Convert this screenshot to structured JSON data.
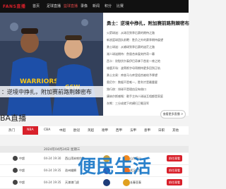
{
  "nav": {
    "logo": "FANS直播",
    "items": [
      "首页",
      "足球直播",
      "篮球直播",
      "录像",
      "新闻",
      "积分",
      "比赛"
    ],
    "active_index": 2
  },
  "hero": {
    "caption": "：逆境中挣扎，附加赛前路荆棘密布"
  },
  "news": {
    "title": "勇士：逆境中挣扎，附加赛前路荆棘密布",
    "items": [
      "火箭球迷：从球员到季后赛的期待之路",
      "新浪篮球团队前瞻：胜负之外的赛季期待展望",
      "勇士球迷：从输球到季后赛的迷茫之路",
      "湖人球迷期待：詹眉合体复刻传奇一幕",
      "西卡：欣慰伏尔泰伊巴奇拿下首发一席之地",
      "雄鹿开场：波蒂斯字母哥期待更多回到正轨",
      "勇士交易：库兹马与库里组合被给予厚望",
      "奥尼尔：数据不是唯一，胜利才是最重要",
      "独行侠：排球不是理由没有借口",
      "康纳尔斯感慨：歌手主持人球迷互相都是家庭",
      "灰熊：三分成就下的横扫卫冕冠军"
    ]
  },
  "section": {
    "title": "BA直播",
    "more_label": "查看更多直播 >"
  },
  "tabs": [
    "热门",
    "NBA",
    "CBA",
    "中超",
    "欧冠",
    "英超",
    "德甲",
    "西甲",
    "法甲",
    "意甲",
    "日职",
    "其他"
  ],
  "active_tab": 1,
  "date_label": "2024年04月24日 星期三",
  "matches": [
    {
      "league": "中超",
      "time": "04-24 19:30",
      "home": "西山湾米哈尔苏",
      "away": "山东泰山",
      "button": "前往观看",
      "home_color": "#c8a040",
      "away_color": "#f08a20"
    },
    {
      "league": "中超",
      "time": "04-24 19:35",
      "home": "沧州雄狮",
      "away": "武汉三镇",
      "button": "前往观看",
      "home_color": "#2c5db8",
      "away_color": "#f07020"
    },
    {
      "league": "中超",
      "time": "04-24 19:35",
      "home": "天津津门虎",
      "away": "长春亚泰",
      "button": "前往观看",
      "home_color": "#1e3d7a",
      "away_color": "#e0a020"
    }
  ],
  "watermark": "便民生活",
  "colors": {
    "accent": "#d8202a",
    "nav_bg": "#111111",
    "watermark": "#1a78c8"
  }
}
